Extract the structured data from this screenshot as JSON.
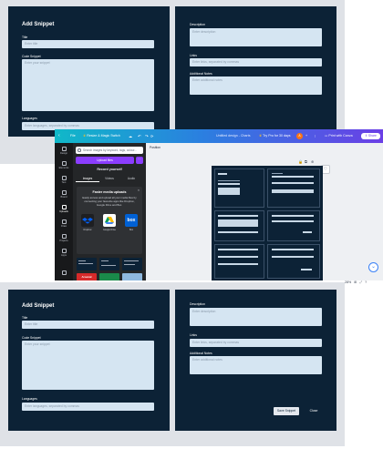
{
  "top_snippet": {
    "title": "Add Snippet",
    "fields": {
      "title": {
        "label": "Title",
        "placeholder": "Enter title"
      },
      "code": {
        "label": "Code Snippet",
        "placeholder": "Enter your snippet"
      },
      "languages": {
        "label": "Languages",
        "placeholder": "Enter languages, separated by commas"
      },
      "description": {
        "label": "Description",
        "placeholder": "Enter description"
      },
      "links": {
        "label": "Links",
        "placeholder": "Enter links, separated by commas"
      },
      "notes": {
        "label": "Additional Notes",
        "placeholder": "Enter additional notes"
      }
    }
  },
  "canva": {
    "topbar": {
      "file": "File",
      "crown_icon": "♛",
      "magic_switch": " Resize & Magic Switch",
      "cloud_icon": "☁",
      "undo_icon": "↶",
      "redo_icon": "↷",
      "sync_icon": "⟳",
      "design_title": "Untitled design - Charts",
      "try_pro": " Try Pro for 30 days",
      "avatar_initial": "A",
      "add_icon": "+",
      "analytics_icon": "⫶",
      "print_icon": "▭",
      "print": " Print with Canva",
      "share_icon": "⇪",
      "share": " Share"
    },
    "rail": [
      "Design",
      "Elements",
      "Text",
      "Brand",
      "Uploads",
      "Draw",
      "Projects",
      "Apps"
    ],
    "panel": {
      "search_placeholder": "Search images by keyword, tags, colour...",
      "upload_button": "Upload files",
      "more_button": "···",
      "record": "Record yourself",
      "tabs": [
        "Images",
        "Videos",
        "Audio"
      ],
      "close_icon": "×",
      "card_title": "Faster media uploads",
      "card_text": "Easily access and upload all your media files by connecting your favourite apps like Dropbox, Google Drive and Box.",
      "apps": [
        {
          "label": "Dropbox"
        },
        {
          "label": "Google Drive"
        },
        {
          "label": "Box",
          "logo": "box"
        }
      ],
      "thumbs": [
        "Arsenal"
      ]
    },
    "canvas": {
      "position_label": "Position",
      "lock_icon": "🔒",
      "duplicate_icon": "⧉",
      "add_page_icon": "⊕",
      "heart_icon": "♡",
      "fab_icon": "⌄"
    },
    "zoom": {
      "percent": "28%",
      "grid_icon": "⊞",
      "fullscreen_icon": "⤢",
      "help_icon": "?"
    }
  },
  "bottom_snippet": {
    "title": "Add Snippet",
    "fields": {
      "title": {
        "label": "Title",
        "placeholder": "Enter title"
      },
      "code": {
        "label": "Code Snippet",
        "placeholder": "Enter your snippet"
      },
      "languages": {
        "label": "Languages",
        "placeholder": "Enter languages, separated by commas"
      },
      "description": {
        "label": "Description",
        "placeholder": "Enter description"
      },
      "links": {
        "label": "Links",
        "placeholder": "Enter links, separated by commas"
      },
      "notes": {
        "label": "Additional Notes",
        "placeholder": "Enter additional notes"
      }
    },
    "buttons": {
      "save": "Save Snippet",
      "close": "Close"
    }
  }
}
